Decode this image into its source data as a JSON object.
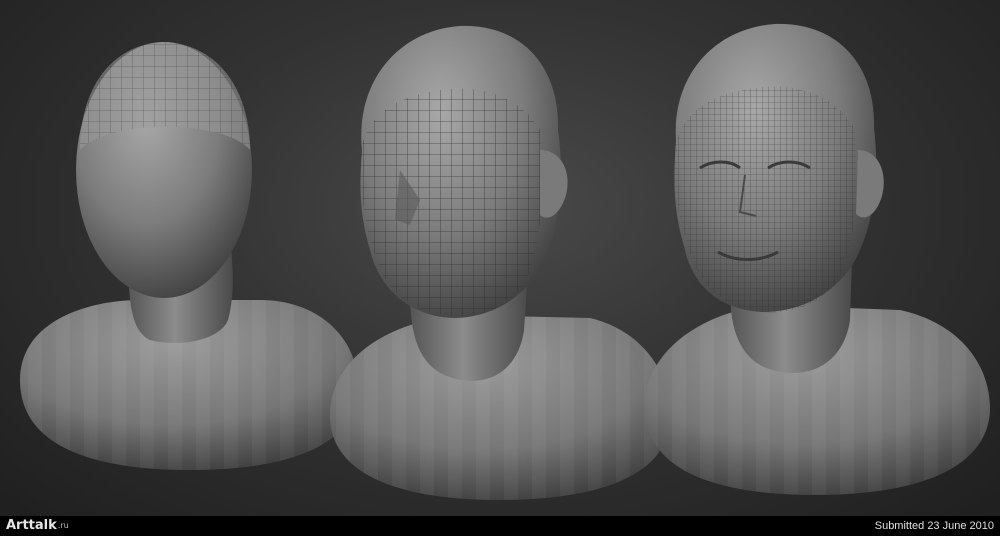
{
  "image": {
    "subject": "three-stage-head-sculpt",
    "busts": [
      {
        "stage": "base-mesh",
        "name": "bust-base"
      },
      {
        "stage": "mid-detail",
        "name": "bust-mid"
      },
      {
        "stage": "high-detail",
        "name": "bust-final"
      }
    ],
    "background_color": "#2f2f2f",
    "clay_color": "#8a8a8a"
  },
  "footer": {
    "logo_text": "Arttalk",
    "logo_domain": ".ru",
    "submitted": "Submitted 23 June 2010"
  }
}
